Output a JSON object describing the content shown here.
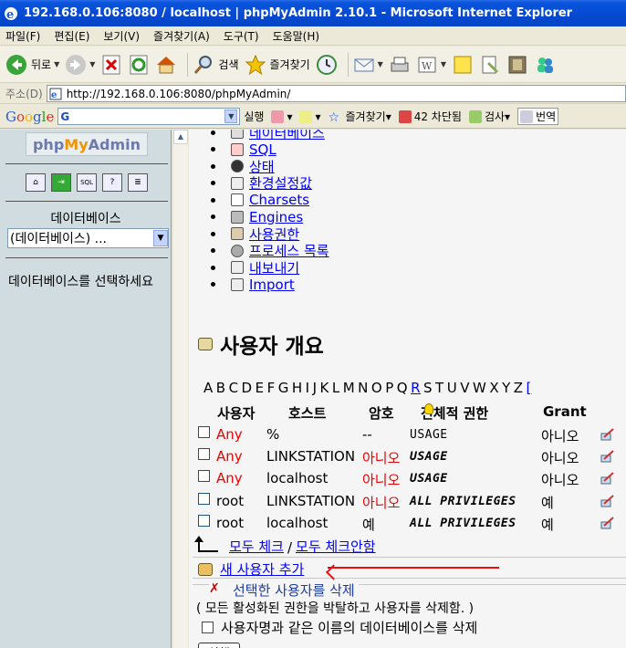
{
  "window": {
    "title": "192.168.0.106:8080 / localhost | phpMyAdmin 2.10.1 - Microsoft Internet Explorer"
  },
  "menubar": [
    "파일(F)",
    "편집(E)",
    "보기(V)",
    "즐겨찾기(A)",
    "도구(T)",
    "도움말(H)"
  ],
  "toolbar": {
    "back": "뒤로",
    "search": "검색",
    "favorites": "즐겨찾기"
  },
  "address": {
    "label": "주소(D)",
    "url": "http://192.168.0.106:8080/phpMyAdmin/"
  },
  "googlebar": {
    "logo": "Google",
    "g_letter": "G",
    "run": "실행",
    "favorites": "즐겨찾기",
    "blocked": "42 차단됨",
    "check": "검사",
    "translate": "번역"
  },
  "left": {
    "logo_php": "php",
    "logo_my": "My",
    "logo_admin": "Admin",
    "db_label": "데이터베이스",
    "db_select": "(데이터베이스) ...",
    "message": "데이터베이스를 선택하세요"
  },
  "menu_links": [
    {
      "icon": "database-icon",
      "label": "데이터베이스"
    },
    {
      "icon": "sql-icon",
      "label": "SQL"
    },
    {
      "icon": "status-icon",
      "label": "상태"
    },
    {
      "icon": "variables-icon",
      "label": "환경설정값"
    },
    {
      "icon": "charsets-icon",
      "label": "Charsets"
    },
    {
      "icon": "engines-icon",
      "label": "Engines"
    },
    {
      "icon": "privileges-icon",
      "label": "사용권한"
    },
    {
      "icon": "processes-icon",
      "label": "프로세스 목록"
    },
    {
      "icon": "export-icon",
      "label": "내보내기"
    },
    {
      "icon": "import-icon",
      "label": "Import"
    }
  ],
  "users_section": {
    "title": "사용자 개요",
    "alphabet": [
      "A",
      "B",
      "C",
      "D",
      "E",
      "F",
      "G",
      "H",
      "I",
      "J",
      "K",
      "L",
      "M",
      "N",
      "O",
      "P",
      "Q",
      "R",
      "S",
      "T",
      "U",
      "V",
      "W",
      "X",
      "Y",
      "Z"
    ],
    "alphabet_active": "R",
    "alphabet_tail": "[",
    "columns": {
      "user": "사용자",
      "host": "호스트",
      "password": "암호",
      "global_privileges": "전체적 권한",
      "grant": "Grant"
    },
    "rows": [
      {
        "user": "Any",
        "host": "%",
        "password": "--",
        "privileges": "USAGE",
        "grant": "아니오"
      },
      {
        "user": "Any",
        "host": "LINKSTATION",
        "password": "아니오",
        "privileges": "USAGE",
        "grant": "아니오"
      },
      {
        "user": "Any",
        "host": "localhost",
        "password": "아니오",
        "privileges": "USAGE",
        "grant": "아니오"
      },
      {
        "user": "root",
        "host": "LINKSTATION",
        "password": "아니오",
        "privileges": "ALL PRIVILEGES",
        "grant": "예"
      },
      {
        "user": "root",
        "host": "localhost",
        "password": "예",
        "privileges": "ALL PRIVILEGES",
        "grant": "예"
      }
    ],
    "check_all": "모두 체크",
    "slash": "/",
    "uncheck_all": "모두 체크안함",
    "add_user": "새 사용자 추가",
    "delete_header": "선택한 사용자를 삭제",
    "delete_note": "( 모든 활성화된 권한을 박탈하고 사용자를 삭제함. )",
    "delete_db_option": "사용자명과 같은 이름의 데이터베이스를 삭제",
    "execute": "실행"
  }
}
